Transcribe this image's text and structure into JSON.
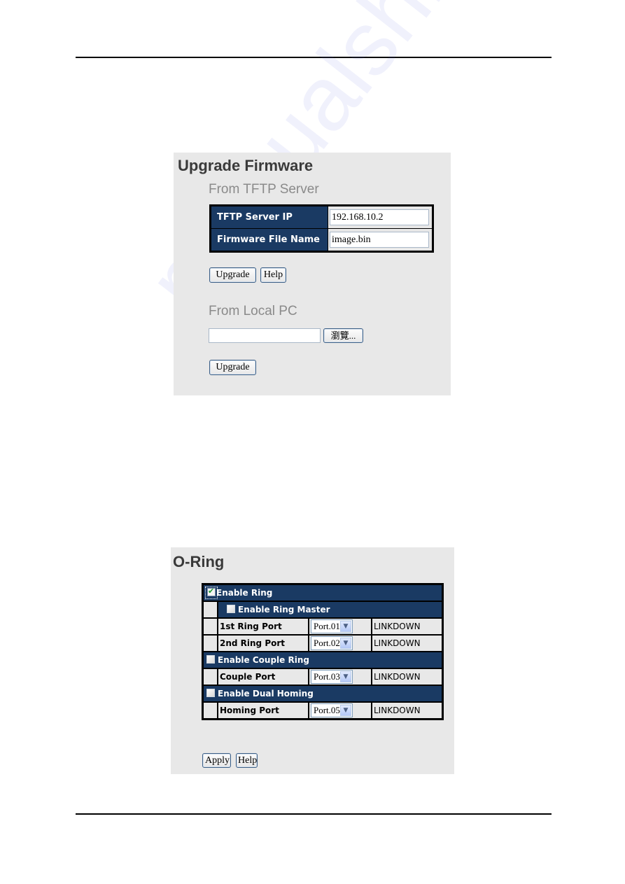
{
  "watermark": "manualshive.com",
  "upgrade_firmware": {
    "title": "Upgrade Firmware",
    "tftp_section": {
      "heading": "From TFTP Server",
      "fields": [
        {
          "label": "TFTP Server IP",
          "value": "192.168.10.2"
        },
        {
          "label": "Firmware File Name",
          "value": "image.bin"
        }
      ],
      "upgrade_label": "Upgrade",
      "help_label": "Help"
    },
    "local_section": {
      "heading": "From Local PC",
      "file_value": "",
      "browse_label": "瀏覽...",
      "upgrade_label": "Upgrade"
    }
  },
  "oring": {
    "title": "O-Ring",
    "enable_ring": {
      "label": "Enable Ring",
      "checked": true
    },
    "enable_ring_master": {
      "label": "Enable Ring Master",
      "checked": false
    },
    "ring_ports": [
      {
        "label": "1st Ring Port",
        "selected": "Port.01",
        "status": "LINKDOWN"
      },
      {
        "label": "2nd Ring Port",
        "selected": "Port.02",
        "status": "LINKDOWN"
      }
    ],
    "enable_couple_ring": {
      "label": "Enable Couple Ring",
      "checked": false
    },
    "couple_port": {
      "label": "Couple Port",
      "selected": "Port.03",
      "status": "LINKDOWN"
    },
    "enable_dual_homing": {
      "label": "Enable Dual Homing",
      "checked": false
    },
    "homing_port": {
      "label": "Homing Port",
      "selected": "Port.05",
      "status": "LINKDOWN"
    },
    "apply_label": "Apply",
    "help_label": "Help"
  },
  "colors": {
    "header_bg": "#1a3a63",
    "panel_bg": "#e8e8e8",
    "check_green": "#1e9a2e"
  }
}
